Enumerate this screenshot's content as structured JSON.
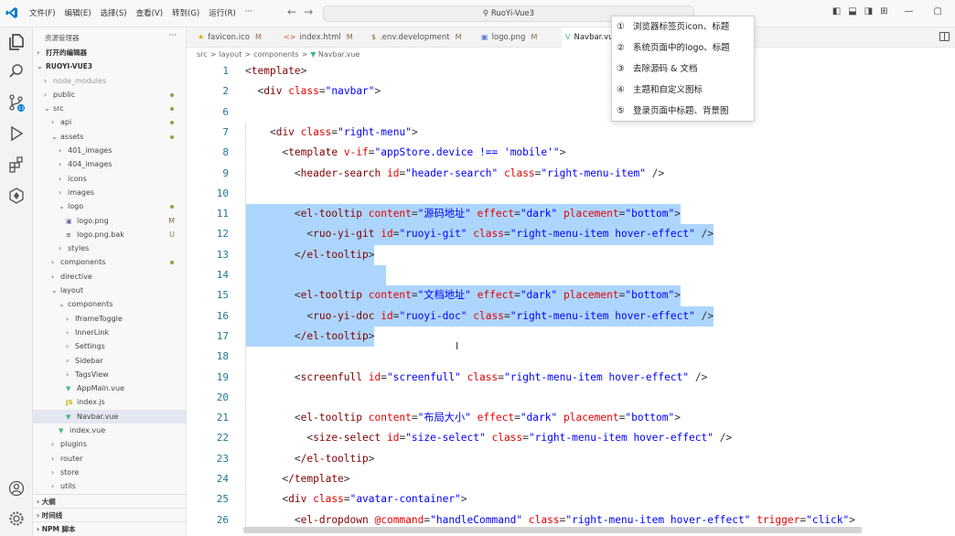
{
  "titlebar": {
    "menu": [
      "文件(F)",
      "编辑(E)",
      "选择(S)",
      "查看(V)",
      "转到(G)",
      "运行(R)",
      "···"
    ],
    "search_text": "RuoYi-Vue3"
  },
  "sidebar": {
    "header": "资源管理器",
    "items": [
      {
        "label": "打开的编辑器",
        "depth": 0,
        "chev": "›",
        "bold": true
      },
      {
        "label": "RUOYI-VUE3",
        "depth": 0,
        "chev": "⌄",
        "bold": true
      },
      {
        "label": "node_modules",
        "depth": 1,
        "chev": "›",
        "muted": true
      },
      {
        "label": "public",
        "depth": 1,
        "chev": "›",
        "dot": true
      },
      {
        "label": "src",
        "depth": 1,
        "chev": "⌄",
        "dot": true
      },
      {
        "label": "api",
        "depth": 2,
        "chev": "›",
        "dot": true
      },
      {
        "label": "assets",
        "depth": 2,
        "chev": "⌄",
        "dot": true
      },
      {
        "label": "401_images",
        "depth": 3,
        "chev": "›"
      },
      {
        "label": "404_images",
        "depth": 3,
        "chev": "›"
      },
      {
        "label": "icons",
        "depth": 3,
        "chev": "›"
      },
      {
        "label": "images",
        "depth": 3,
        "chev": "›"
      },
      {
        "label": "logo",
        "depth": 3,
        "chev": "⌄",
        "dot": true
      },
      {
        "label": "logo.png",
        "depth": 4,
        "icon": "img",
        "badge": "M"
      },
      {
        "label": "logo.png.bak",
        "depth": 4,
        "icon": "file",
        "badge": "U"
      },
      {
        "label": "styles",
        "depth": 3,
        "chev": "›"
      },
      {
        "label": "components",
        "depth": 2,
        "chev": "›",
        "dot": true
      },
      {
        "label": "directive",
        "depth": 2,
        "chev": "›"
      },
      {
        "label": "layout",
        "depth": 2,
        "chev": "⌄"
      },
      {
        "label": "components",
        "depth": 3,
        "chev": "⌄"
      },
      {
        "label": "IframeToggle",
        "depth": 4,
        "chev": "›"
      },
      {
        "label": "InnerLink",
        "depth": 4,
        "chev": "›"
      },
      {
        "label": "Settings",
        "depth": 4,
        "chev": "›"
      },
      {
        "label": "Sidebar",
        "depth": 4,
        "chev": "›"
      },
      {
        "label": "TagsView",
        "depth": 4,
        "chev": "›"
      },
      {
        "label": "AppMain.vue",
        "depth": 4,
        "icon": "vue"
      },
      {
        "label": "index.js",
        "depth": 4,
        "icon": "js"
      },
      {
        "label": "Navbar.vue",
        "depth": 4,
        "icon": "vue",
        "selected": true
      },
      {
        "label": "index.vue",
        "depth": 3,
        "icon": "vue"
      },
      {
        "label": "plugins",
        "depth": 2,
        "chev": "›"
      },
      {
        "label": "router",
        "depth": 2,
        "chev": "›"
      },
      {
        "label": "store",
        "depth": 2,
        "chev": "›"
      },
      {
        "label": "utils",
        "depth": 2,
        "chev": "›"
      }
    ],
    "sections": [
      "大纲",
      "时间线",
      "NPM 脚本"
    ]
  },
  "tabs": [
    {
      "label": "favicon.ico",
      "icon": "★",
      "status": "M"
    },
    {
      "label": "index.html",
      "icon": "<>",
      "status": "M"
    },
    {
      "label": ".env.development",
      "icon": "$",
      "status": "M"
    },
    {
      "label": "logo.png",
      "icon": "▣",
      "status": "M"
    },
    {
      "label": "Navbar.vu",
      "icon": "V",
      "status": "",
      "active": true
    }
  ],
  "breadcrumb": [
    "src",
    "layout",
    "components",
    "Navbar.vue"
  ],
  "editor": {
    "lines": [
      {
        "num": "1",
        "code": "<template>"
      },
      {
        "num": "2",
        "code": "  <div class=\"navbar\">"
      },
      {
        "num": "6",
        "code": ""
      },
      {
        "num": "7",
        "code": "    <div class=\"right-menu\">"
      },
      {
        "num": "8",
        "code": "      <template v-if=\"appStore.device !== 'mobile'\">"
      },
      {
        "num": "9",
        "code": "        <header-search id=\"header-search\" class=\"right-menu-item\" />"
      },
      {
        "num": "10",
        "code": ""
      },
      {
        "num": "11",
        "code": "        <el-tooltip content=\"源码地址\" effect=\"dark\" placement=\"bottom\">"
      },
      {
        "num": "12",
        "code": "          <ruo-yi-git id=\"ruoyi-git\" class=\"right-menu-item hover-effect\" />"
      },
      {
        "num": "13",
        "code": "        </el-tooltip>"
      },
      {
        "num": "14",
        "code": ""
      },
      {
        "num": "15",
        "code": "        <el-tooltip content=\"文档地址\" effect=\"dark\" placement=\"bottom\">"
      },
      {
        "num": "16",
        "code": "          <ruo-yi-doc id=\"ruoyi-doc\" class=\"right-menu-item hover-effect\" />"
      },
      {
        "num": "17",
        "code": "        </el-tooltip>"
      },
      {
        "num": "18",
        "code": ""
      },
      {
        "num": "19",
        "code": "        <screenfull id=\"screenfull\" class=\"right-menu-item hover-effect\" />"
      },
      {
        "num": "20",
        "code": ""
      },
      {
        "num": "21",
        "code": "        <el-tooltip content=\"布局大小\" effect=\"dark\" placement=\"bottom\">"
      },
      {
        "num": "22",
        "code": "          <size-select id=\"size-select\" class=\"right-menu-item hover-effect\" />"
      },
      {
        "num": "23",
        "code": "        </el-tooltip>"
      },
      {
        "num": "24",
        "code": "      </template>"
      },
      {
        "num": "25",
        "code": "      <div class=\"avatar-container\">"
      },
      {
        "num": "26",
        "code": "        <el-dropdown @command=\"handleCommand\" class=\"right-menu-item hover-effect\" trigger=\"click\">"
      }
    ]
  },
  "popup": {
    "items": [
      {
        "num": "①",
        "text": "浏览器标签页icon、标题"
      },
      {
        "num": "②",
        "text": "系统页面中的logo、标题"
      },
      {
        "num": "③",
        "text": "去除源码 & 文档"
      },
      {
        "num": "④",
        "text": "主题和自定义图标"
      },
      {
        "num": "⑤",
        "text": "登录页面中标题、背景图"
      }
    ]
  },
  "colors": {
    "accent": "#007acc",
    "selection": "#add6ff",
    "tag": "#800000",
    "attr": "#e50000",
    "string": "#0000ff",
    "line_number": "#237893"
  }
}
